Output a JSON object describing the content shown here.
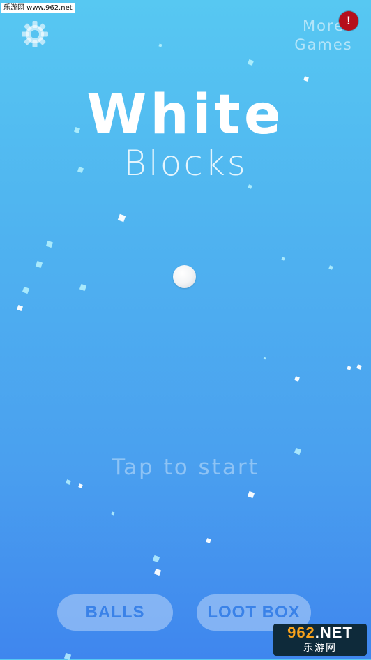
{
  "watermark": {
    "top": "乐游网 www.962.net",
    "bottom_line1_num": "962",
    "bottom_line1_rest": ".NET",
    "bottom_line2": "乐游网"
  },
  "header": {
    "more_games_line1": "More",
    "more_games_line2": "Games",
    "alert_badge": "!"
  },
  "title": {
    "main": "White",
    "sub": "Blocks"
  },
  "prompt": "Tap to start",
  "buttons": {
    "balls": "BALLS",
    "loot_box": "LOOT BOX"
  },
  "icons": {
    "settings": "gear-icon",
    "alert": "exclamation-badge"
  },
  "colors": {
    "background_top": "#57c8f2",
    "background_bottom": "#3f86ee",
    "button_text": "#3a82e8",
    "alert_badge": "#b50f1c"
  }
}
